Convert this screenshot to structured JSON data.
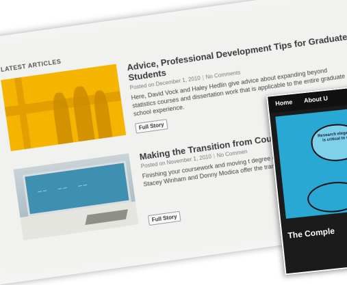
{
  "section": {
    "title": "LATEST ARTICLES"
  },
  "articles": [
    {
      "title": "Advice, Professional Development Tips for Graduate Students",
      "date": "Posted on December 1, 2010",
      "comments": "No Comments",
      "excerpt": "Here, David Vock and Haley Hedlin give advice about expanding beyond statistics courses and dissertation work that is applicable to the entire graduate school experience.",
      "button": "Full Story"
    },
    {
      "title": "Making the Transition from Cour",
      "date": "Posted on November 1, 2010",
      "comments": "No Commen",
      "excerpt": "Finishing your coursework and moving t degree can be exhilarating and nerve-r Stacey Winham and Donny Modica offer the transition.",
      "button": "Full Story"
    }
  ],
  "overlay": {
    "nav": [
      "Home",
      "About U"
    ],
    "bubble_text": "Research elegantly is critical to un",
    "headline": "The Comple"
  }
}
